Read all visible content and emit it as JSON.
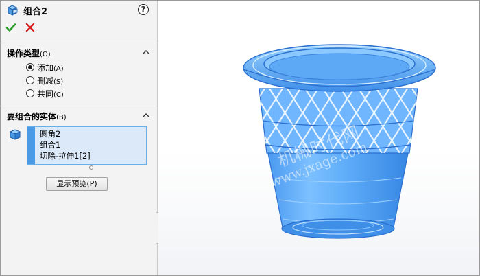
{
  "property_manager": {
    "feature_title": "组合2",
    "help_label": "?",
    "operation_section": {
      "title": "操作类型",
      "hotkey": "(O)",
      "options": [
        {
          "label": "添加",
          "hotkey": "(A)",
          "selected": true
        },
        {
          "label": "删减",
          "hotkey": "(S)",
          "selected": false
        },
        {
          "label": "共同",
          "hotkey": "(C)",
          "selected": false
        }
      ]
    },
    "bodies_section": {
      "title": "要组合的实体",
      "hotkey": "(B)",
      "items": [
        "圆角2",
        "组合1",
        "切除-拉伸1[2]"
      ]
    },
    "preview_button": "显示预览(P)"
  },
  "viewport": {
    "watermark_cn": "机械时代网",
    "watermark_url": "www.jxage.com"
  },
  "colors": {
    "model_blue": "#4fa3ff",
    "model_dark": "#1e6fd9",
    "selection_accent": "#4a9ae6",
    "ok_green": "#2aa02a",
    "cancel_red": "#d81e1e"
  }
}
